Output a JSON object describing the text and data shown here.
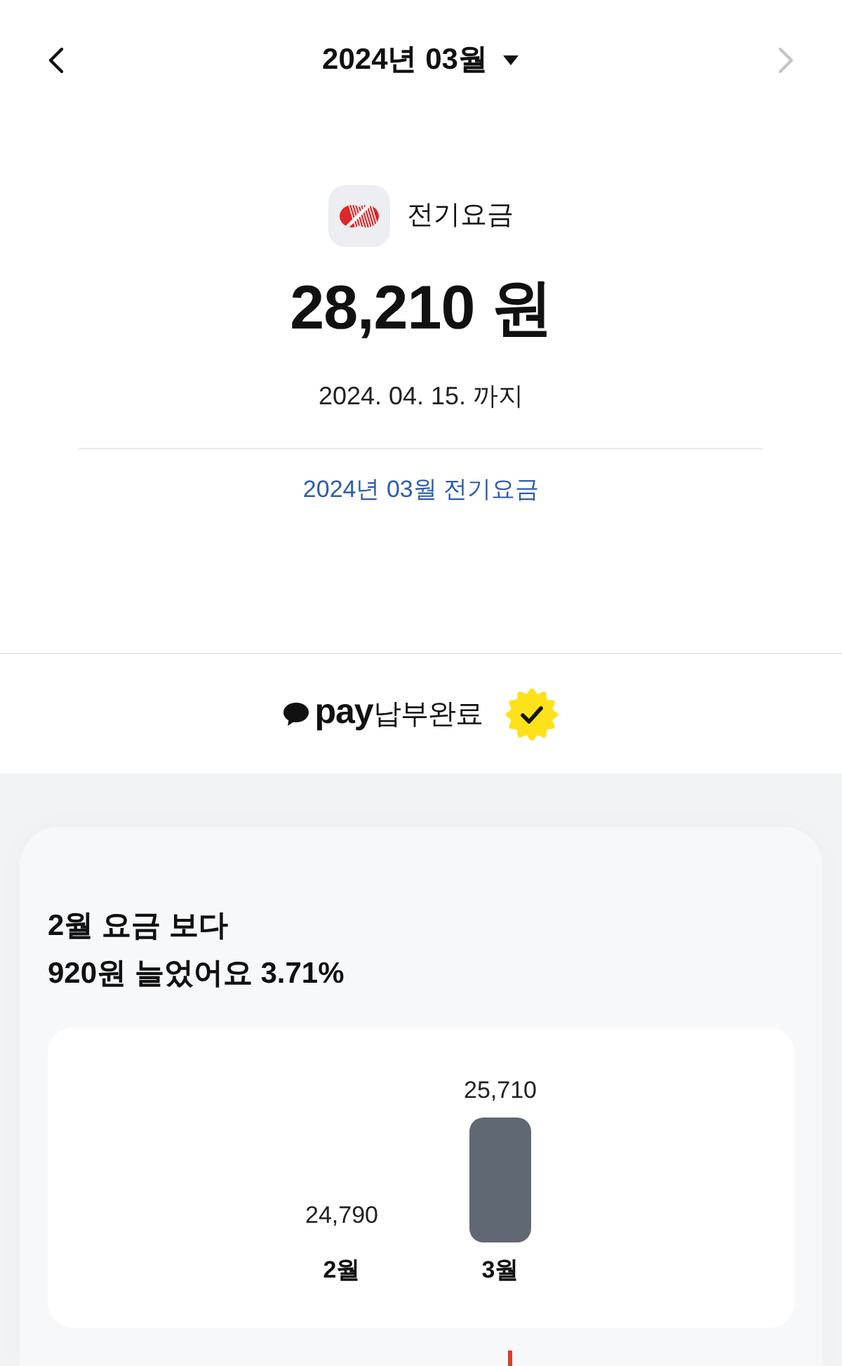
{
  "header": {
    "title": "2024년 03월",
    "nav": [
      {
        "kind": "prev",
        "disabled": false
      },
      {
        "kind": "next",
        "disabled": true
      }
    ]
  },
  "bill": {
    "name": "전기요금",
    "amount": "28,210 원",
    "due": "2024. 04. 15. 까지",
    "link": "2024년 03월 전기요금"
  },
  "payment": {
    "brand": "pay",
    "status": "납부완료",
    "completed": true
  },
  "comparison": {
    "headline": [
      "2월 요금 보다",
      "920원 늘었어요 3.71%"
    ],
    "chart_data": {
      "type": "bar",
      "categories": [
        "2월",
        "3월"
      ],
      "values": [
        24790,
        25710
      ],
      "ylim": [
        24790,
        25710
      ],
      "value_labels": [
        "24,790",
        "25,710"
      ]
    }
  }
}
